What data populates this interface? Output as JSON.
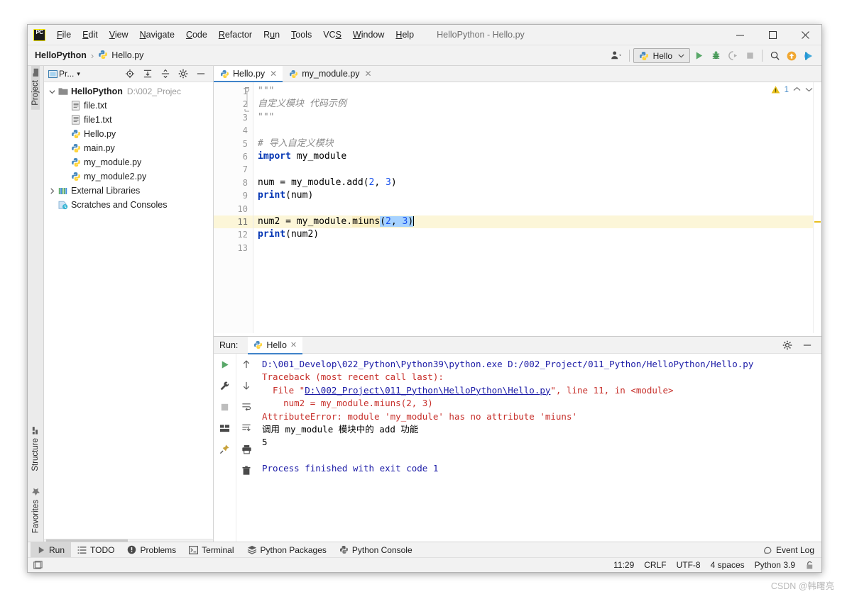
{
  "window": {
    "title": "HelloPython - Hello.py",
    "controls": {
      "minimize": "—",
      "maximize": "□",
      "close": "✕"
    }
  },
  "menubar": {
    "logo_text": "PC",
    "items": [
      {
        "label": "File",
        "mnemonic": "F"
      },
      {
        "label": "Edit",
        "mnemonic": "E"
      },
      {
        "label": "View",
        "mnemonic": "V"
      },
      {
        "label": "Navigate",
        "mnemonic": "N"
      },
      {
        "label": "Code",
        "mnemonic": "C"
      },
      {
        "label": "Refactor",
        "mnemonic": "R"
      },
      {
        "label": "Run",
        "mnemonic": "R"
      },
      {
        "label": "Tools",
        "mnemonic": "T"
      },
      {
        "label": "VCS",
        "mnemonic": "S"
      },
      {
        "label": "Window",
        "mnemonic": "W"
      },
      {
        "label": "Help",
        "mnemonic": "H"
      }
    ]
  },
  "navbar": {
    "breadcrumb_project": "HelloPython",
    "breadcrumb_sep": "›",
    "breadcrumb_file": "Hello.py",
    "run_config": "Hello",
    "run_config_chevron": "⌄",
    "icons": [
      "user-settings-icon",
      "run-icon",
      "debug-icon",
      "run-coverage-icon",
      "stop-icon",
      "search-everywhere-icon",
      "update-project-icon",
      "ide-helper-icon"
    ]
  },
  "left_strip": {
    "top_tab": "Project",
    "bottom_tabs": [
      "Structure",
      "Favorites"
    ]
  },
  "project_panel": {
    "title": "Pr...",
    "title_chevron": "▾",
    "toolbar_icons": [
      "locate-icon",
      "expand-all-icon",
      "collapse-all-icon",
      "gear-icon",
      "hide-icon"
    ],
    "tree": [
      {
        "label": "HelloPython",
        "sub": "D:\\002_Projec",
        "icon": "folder-icon",
        "arrow": "expanded",
        "depth": 0,
        "bold": true
      },
      {
        "label": "file.txt",
        "sub": "",
        "icon": "text-file-icon",
        "arrow": "none",
        "depth": 1,
        "bold": false
      },
      {
        "label": "file1.txt",
        "sub": "",
        "icon": "text-file-icon",
        "arrow": "none",
        "depth": 1,
        "bold": false
      },
      {
        "label": "Hello.py",
        "sub": "",
        "icon": "python-file-icon",
        "arrow": "none",
        "depth": 1,
        "bold": false
      },
      {
        "label": "main.py",
        "sub": "",
        "icon": "python-file-icon",
        "arrow": "none",
        "depth": 1,
        "bold": false
      },
      {
        "label": "my_module.py",
        "sub": "",
        "icon": "python-file-icon",
        "arrow": "none",
        "depth": 1,
        "bold": false
      },
      {
        "label": "my_module2.py",
        "sub": "",
        "icon": "python-file-icon",
        "arrow": "none",
        "depth": 1,
        "bold": false
      },
      {
        "label": "External Libraries",
        "sub": "",
        "icon": "libraries-icon",
        "arrow": "collapsed",
        "depth": 0,
        "bold": false
      },
      {
        "label": "Scratches and Consoles",
        "sub": "",
        "icon": "scratches-icon",
        "arrow": "none",
        "depth": 0,
        "bold": false
      }
    ]
  },
  "editor": {
    "tabs": [
      {
        "label": "Hello.py",
        "icon": "python-file-icon",
        "active": true,
        "close": "✕"
      },
      {
        "label": "my_module.py",
        "icon": "python-file-icon",
        "active": false,
        "close": "✕"
      }
    ],
    "warning_count": "1",
    "warning_icon": "warning-triangle-icon",
    "prev_icon": "⌃",
    "next_icon": "⌄",
    "line_numbers": [
      "1",
      "2",
      "3",
      "4",
      "5",
      "6",
      "7",
      "8",
      "9",
      "10",
      "11",
      "12",
      "13"
    ],
    "current_line": 11,
    "lines": [
      "\"\"\"",
      "自定义模块 代码示例",
      "\"\"\"",
      "",
      "# 导入自定义模块",
      "import my_module",
      "",
      "num = my_module.add(2, 3)",
      "print(num)",
      "",
      "num2 = my_module.miuns(2, 3)",
      "print(num2)",
      ""
    ]
  },
  "run_panel": {
    "label": "Run:",
    "tab": "Hello",
    "tab_icon": "python-file-icon",
    "tab_close": "✕",
    "header_icons": [
      "gear-icon",
      "minimize-icon"
    ],
    "toolbar_icons": [
      "rerun-icon",
      "wrench-icon",
      "stop-icon",
      "layout-icon",
      "pin-icon"
    ],
    "toolbar2_icons": [
      "up-arrow-icon",
      "down-arrow-icon",
      "soft-wrap-icon",
      "scroll-to-end-icon",
      "print-icon",
      "trash-icon"
    ],
    "console": [
      {
        "text": "D:\\001_Develop\\022_Python\\Python39\\python.exe D:/002_Project/011_Python/HelloPython/Hello.py",
        "style": "blue"
      },
      {
        "text": "Traceback (most recent call last):",
        "style": "red"
      },
      {
        "text": "  File \"D:\\002_Project\\011_Python\\HelloPython\\Hello.py\", line 11, in <module>",
        "style": "red-link"
      },
      {
        "text": "    num2 = my_module.miuns(2, 3)",
        "style": "red"
      },
      {
        "text": "AttributeError: module 'my_module' has no attribute 'miuns'",
        "style": "red"
      },
      {
        "text": "调用 my_module 模块中的 add 功能",
        "style": "black"
      },
      {
        "text": "5",
        "style": "black"
      },
      {
        "text": "",
        "style": "black"
      },
      {
        "text": "Process finished with exit code 1",
        "style": "blue"
      }
    ],
    "console_link_text": "D:\\002_Project\\011_Python\\HelloPython\\Hello.py"
  },
  "bottom_tabs": [
    {
      "label": "Run",
      "icon": "run-icon",
      "active": true
    },
    {
      "label": "TODO",
      "icon": "todo-icon",
      "active": false
    },
    {
      "label": "Problems",
      "icon": "problems-icon",
      "active": false
    },
    {
      "label": "Terminal",
      "icon": "terminal-icon",
      "active": false
    },
    {
      "label": "Python Packages",
      "icon": "packages-icon",
      "active": false
    },
    {
      "label": "Python Console",
      "icon": "python-console-icon",
      "active": false
    }
  ],
  "event_log": {
    "label": "Event Log",
    "icon": "event-log-icon"
  },
  "status_bar": {
    "left_icon": "window-layout-icon",
    "cursor_position": "11:29",
    "line_separator": "CRLF",
    "encoding": "UTF-8",
    "indent": "4 spaces",
    "interpreter": "Python 3.9",
    "lock_icon": "lock-icon"
  },
  "watermark": "CSDN @韩曙亮",
  "colors": {
    "accent_blue": "#4083c9",
    "keyword_blue": "#0033b3",
    "number_blue": "#1750eb",
    "comment_gray": "#8c8c8c",
    "error_red": "#c7302b",
    "console_blue": "#1a1aa6",
    "current_line_bg": "#fcf6d8",
    "selection_blue": "#a6d2ff",
    "warning_yellow": "#e8bf1d",
    "python_green": "#4b8b3b",
    "toolbar_bg": "#f2f2f2"
  }
}
